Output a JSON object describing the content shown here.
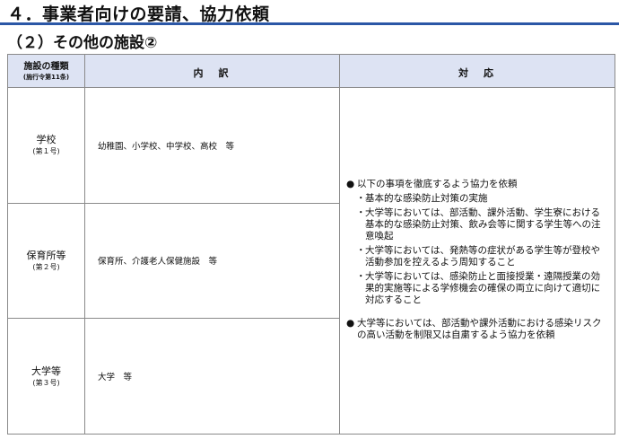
{
  "title": "４．事業者向けの要請、協力依頼",
  "subtitle": "（２）その他の施設②",
  "table": {
    "headers": {
      "facility_type": "施設の種類",
      "facility_type_note": "(施行令第11条)",
      "breakdown": "内　訳",
      "response": "対　応"
    },
    "rows": [
      {
        "name": "学校",
        "article": "(第１号)",
        "detail": "幼稚園、小学校、中学校、高校　等"
      },
      {
        "name": "保育所等",
        "article": "(第２号)",
        "detail": "保育所、介護老人保健施設　等"
      },
      {
        "name": "大学等",
        "article": "(第３号)",
        "detail": "大学　等"
      }
    ],
    "response": {
      "bullet_1": "以下の事項を徹底するよう協力を依頼",
      "sub_items": [
        "基本的な感染防止対策の実施",
        "大学等においては、部活動、課外活動、学生寮における基本的な感染防止対策、飲み会等に関する学生等への注意喚起",
        "大学等においては、発熱等の症状がある学生等が登校や活動参加を控えるよう周知すること",
        "大学等においては、感染防止と面接授業・遠隔授業の効果的実施等による学修機会の確保の両立に向けて適切に対応すること"
      ],
      "bullet_2": "大学等においては、部活動や課外活動における感染リスクの高い活動を制限又は自粛するよう協力を依頼",
      "bullet_mark": "●",
      "sub_mark": "・"
    }
  },
  "colors": {
    "accent_rule": "#2b57a6",
    "header_bg": "#dde3f3"
  }
}
